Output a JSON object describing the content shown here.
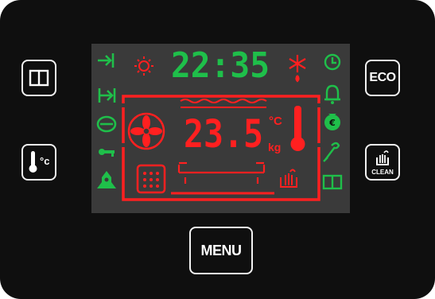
{
  "display": {
    "clock": "22:35",
    "temperature": "23.5",
    "unit_celsius": "°C",
    "unit_kg": "kg",
    "colors": {
      "green": "#1fbf4a",
      "red": "#ff2020",
      "background": "#3a3a3a"
    }
  },
  "buttons": {
    "eco_label": "ECO",
    "menu_label": "MENU",
    "clean_label": "CLEAN",
    "temp_unit": "°c"
  },
  "icons": {
    "left_column": [
      "end-arrow-icon",
      "duration-arrow-icon",
      "lock-icon",
      "key-icon",
      "rocket-preheat-icon"
    ],
    "right_column": [
      "clock-icon",
      "bell-icon",
      "money-bag-icon",
      "probe-icon",
      "book-icon"
    ],
    "top": [
      "sun-light-icon",
      "snowflake-defrost-icon"
    ],
    "cavity": [
      "fan-icon",
      "grill-icon",
      "thermometer-icon",
      "steam-clean-icon",
      "heating-element-icon"
    ]
  }
}
